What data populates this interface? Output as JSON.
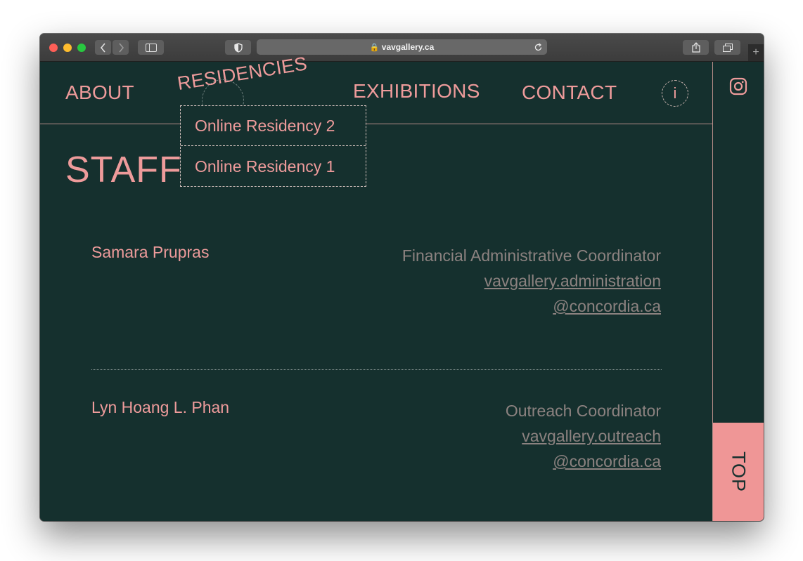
{
  "browser": {
    "url": "vavgallery.ca",
    "colors": {
      "close": "#ff5f57",
      "minimize": "#febc2e",
      "zoom": "#28c840"
    }
  },
  "nav": {
    "about": "ABOUT",
    "residencies": "RESIDENCIES",
    "exhibitions": "EXHIBITIONS",
    "contact": "CONTACT",
    "info": "i"
  },
  "dropdown": {
    "items": [
      "Online Residency 2",
      "Online Residency 1"
    ]
  },
  "page": {
    "title": "STAFF"
  },
  "staff": [
    {
      "name": "Samara Prupras",
      "role": "Financial Administrative Coordinator",
      "email_line1": "vavgallery.administration",
      "email_line2": "@concordia.ca"
    },
    {
      "name": "Lyn Hoang L. Phan",
      "role": "Outreach Coordinator",
      "email_line1": "vavgallery.outreach",
      "email_line2": "@concordia.ca"
    }
  ],
  "rail": {
    "top_label": "TOP",
    "instagram_icon": "instagram-icon"
  },
  "theme": {
    "background": "#15302e",
    "accent": "#ee9b9b"
  }
}
